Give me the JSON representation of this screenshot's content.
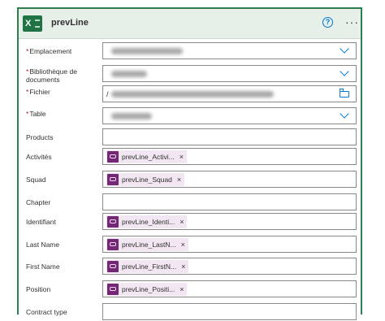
{
  "card": {
    "title": "prevLine",
    "help_icon": "question-circle-icon",
    "more_icon": "ellipsis-icon",
    "accent": "#217346"
  },
  "fields": {
    "emplacement": {
      "label": "Emplacement",
      "required": true
    },
    "bibliotheque": {
      "label": "Bibliothèque de documents",
      "required": true
    },
    "fichier": {
      "label": "Fichier",
      "required": true,
      "value_prefix": "/"
    },
    "table": {
      "label": "Table",
      "required": true
    },
    "products": {
      "label": "Products"
    },
    "activites": {
      "label": "Activités",
      "token": "prevLine_Activi..."
    },
    "squad": {
      "label": "Squad",
      "token": "prevLine_Squad"
    },
    "chapter": {
      "label": "Chapter"
    },
    "identifiant": {
      "label": "Identifiant",
      "token": "prevLine_Identi..."
    },
    "last_name": {
      "label": "Last Name",
      "token": "prevLine_LastN..."
    },
    "first_name": {
      "label": "First Name",
      "token": "prevLine_FirstN..."
    },
    "position": {
      "label": "Position",
      "token": "prevLine_Positi..."
    },
    "contract_type": {
      "label": "Contract type"
    }
  },
  "token_remove": "×",
  "required_mark": "*"
}
